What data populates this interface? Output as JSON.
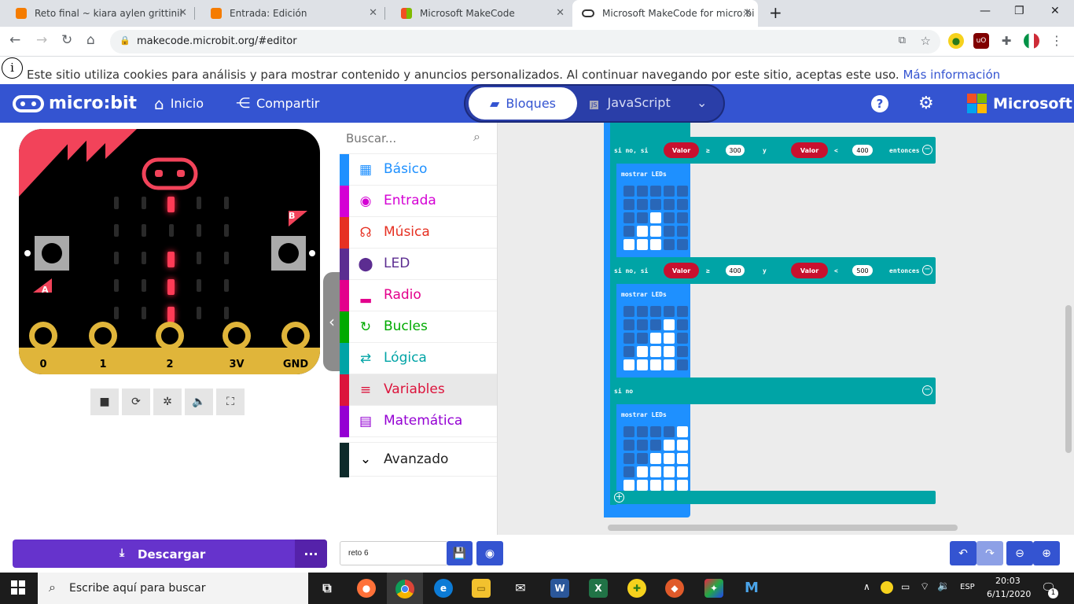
{
  "browser": {
    "tabs": [
      {
        "title": "Reto final ~ kiara aylen grittinii",
        "favicon_color": "#f57c00"
      },
      {
        "title": "Entrada: Edición",
        "favicon_color": "#f57c00"
      },
      {
        "title": "Microsoft MakeCode",
        "favicon_color": "#7fba00"
      },
      {
        "title": "Microsoft MakeCode for micro:bi",
        "favicon_color": "#333333"
      }
    ],
    "url": "makecode.microbit.org/#editor"
  },
  "cookie": {
    "text": "Este sitio utiliza cookies para análisis y para mostrar contenido y anuncios personalizados. Al continuar navegando por este sitio, aceptas este uso.",
    "link": "Más información"
  },
  "menu": {
    "logo": "micro:bit",
    "home": "Inicio",
    "share": "Compartir",
    "blocks": "Bloques",
    "javascript": "JavaScript",
    "brand": "Microsoft",
    "accent": "#3454d1"
  },
  "simulator": {
    "pins": [
      "0",
      "1",
      "2",
      "3V",
      "GND"
    ],
    "button_a": "A",
    "button_b": "B",
    "leds_on": [
      [
        0,
        2
      ],
      [
        2,
        2
      ],
      [
        3,
        2
      ],
      [
        4,
        2
      ]
    ]
  },
  "toolbox": {
    "search_placeholder": "Buscar...",
    "categories": [
      {
        "label": "Básico",
        "color": "#1e90ff",
        "icon": "grid-icon"
      },
      {
        "label": "Entrada",
        "color": "#d400d4",
        "icon": "target-icon"
      },
      {
        "label": "Música",
        "color": "#e63022",
        "icon": "headphones-icon"
      },
      {
        "label": "LED",
        "color": "#5c2d91",
        "icon": "toggle-icon"
      },
      {
        "label": "Radio",
        "color": "#e3008c",
        "icon": "signal-icon"
      },
      {
        "label": "Bucles",
        "color": "#00aa00",
        "icon": "refresh-icon"
      },
      {
        "label": "Lógica",
        "color": "#00a4a6",
        "icon": "shuffle-icon"
      },
      {
        "label": "Variables",
        "color": "#dc143c",
        "icon": "lines-icon"
      },
      {
        "label": "Matemática",
        "color": "#9400d3",
        "icon": "calculator-icon"
      }
    ],
    "advanced": "Avanzado"
  },
  "workspace": {
    "branch1": {
      "keyword": "si no, si",
      "var1": "Valor",
      "op1": "≥",
      "num1": "300",
      "and": "y",
      "var2": "Valor",
      "op2": "<",
      "num2": "400",
      "then": "entonces",
      "show": "mostrar LEDs"
    },
    "branch2": {
      "keyword": "si no, si",
      "var1": "Valor",
      "op1": "≥",
      "num1": "400",
      "and": "y",
      "var2": "Valor",
      "op2": "<",
      "num2": "500",
      "then": "entonces",
      "show": "mostrar LEDs"
    },
    "branch3": {
      "keyword": "si no",
      "show": "mostrar LEDs"
    },
    "leds": [
      [
        [
          0,
          0,
          0,
          0,
          0
        ],
        [
          0,
          0,
          0,
          0,
          0
        ],
        [
          0,
          0,
          1,
          0,
          0
        ],
        [
          0,
          1,
          1,
          0,
          0
        ],
        [
          1,
          1,
          1,
          0,
          0
        ]
      ],
      [
        [
          0,
          0,
          0,
          0,
          0
        ],
        [
          0,
          0,
          0,
          1,
          0
        ],
        [
          0,
          0,
          1,
          1,
          0
        ],
        [
          0,
          1,
          1,
          1,
          0
        ],
        [
          1,
          1,
          1,
          1,
          0
        ]
      ],
      [
        [
          0,
          0,
          0,
          0,
          1
        ],
        [
          0,
          0,
          0,
          1,
          1
        ],
        [
          0,
          0,
          1,
          1,
          1
        ],
        [
          0,
          1,
          1,
          1,
          1
        ],
        [
          1,
          1,
          1,
          1,
          1
        ]
      ]
    ]
  },
  "bottom": {
    "download": "Descargar",
    "more": "...",
    "project_name": "reto 6"
  },
  "taskbar": {
    "search": "Escribe aquí para buscar",
    "lang": "ESP",
    "time": "20:03",
    "date": "6/11/2020",
    "notifications": "1"
  }
}
